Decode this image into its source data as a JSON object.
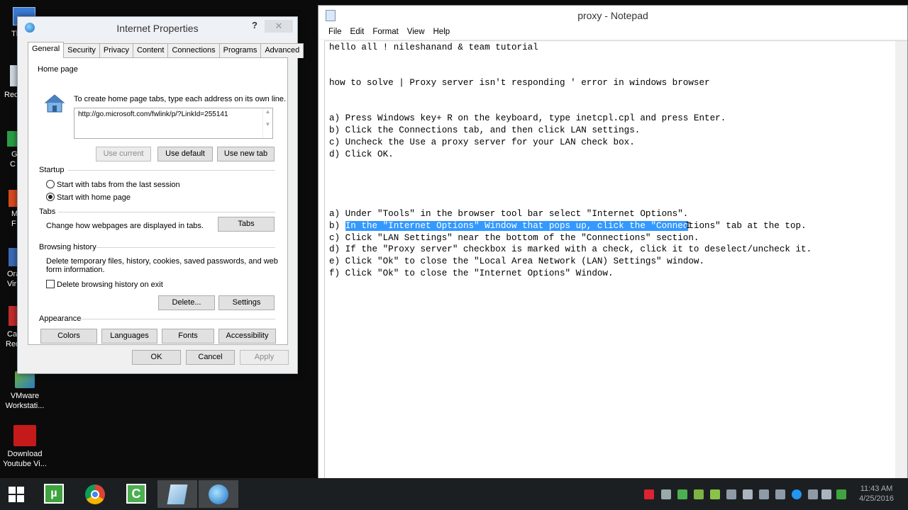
{
  "desktop": {
    "icons": [
      {
        "label1": "VMware",
        "label2": "Workstati..."
      },
      {
        "label1": "Download",
        "label2": "Youtube Vi..."
      }
    ],
    "partial_labels": [
      "Th",
      "Rec",
      "G",
      "C",
      "M",
      "F",
      "Ora",
      "Vir",
      "Ca",
      "Red"
    ]
  },
  "internet_properties": {
    "title": "Internet Properties",
    "help_glyph": "?",
    "close_glyph": "✕",
    "tabs": [
      "General",
      "Security",
      "Privacy",
      "Content",
      "Connections",
      "Programs",
      "Advanced"
    ],
    "home_page": {
      "label": "Home page",
      "hint": "To create home page tabs, type each address on its own line.",
      "url": "http://go.microsoft.com/fwlink/p/?LinkId=255141",
      "use_current": "Use current",
      "use_default": "Use default",
      "use_new_tab": "Use new tab"
    },
    "startup": {
      "label": "Startup",
      "option_last_session": "Start with tabs from the last session",
      "option_home_page": "Start with home page",
      "selected": "home_page"
    },
    "tabs_group": {
      "label": "Tabs",
      "hint": "Change how webpages are displayed in tabs.",
      "button": "Tabs"
    },
    "browsing_history": {
      "label": "Browsing history",
      "hint_line1": "Delete temporary files, history, cookies, saved passwords, and web",
      "hint_line2": "form information.",
      "delete_on_exit": "Delete browsing history on exit",
      "delete_button": "Delete...",
      "settings_button": "Settings"
    },
    "appearance": {
      "label": "Appearance",
      "colors": "Colors",
      "languages": "Languages",
      "fonts": "Fonts",
      "accessibility": "Accessibility"
    },
    "footer": {
      "ok": "OK",
      "cancel": "Cancel",
      "apply": "Apply"
    }
  },
  "notepad": {
    "title": "proxy - Notepad",
    "menu": [
      "File",
      "Edit",
      "Format",
      "View",
      "Help"
    ],
    "lines": {
      "l1": "hello all ! nileshanand & team tutorial",
      "l2": "how to solve | Proxy server isn't responding ' error in windows browser",
      "a1": "a) Press Windows key+ R on the keyboard, type inetcpl.cpl and press Enter.",
      "b1": "b) Click the Connections tab, and then click LAN settings.",
      "c1": "c) Uncheck the Use a proxy server for your LAN check box.",
      "d1": "d) Click OK.",
      "a2": "a) Under \"Tools\" in the browser tool bar select \"Internet Options\".",
      "b2_prefix": "b) ",
      "b2_selected": "In the \"Internet Options\" Window that pops up, click the \"Connec",
      "b2_rest": "tions\" tab at the top.",
      "c2": "c) Click \"LAN Settings\" near the bottom of the \"Connections\" section.",
      "d2": "d) If the \"Proxy server\" checkbox is marked with a check, click it to deselect/uncheck it.",
      "e2": "e) Click \"Ok\" to close the \"Local Area Network (LAN) Settings\" window.",
      "f2": "f) Click \"Ok\" to close the \"Internet Options\" Window."
    }
  },
  "taskbar": {
    "clock_time": "11:43 AM",
    "clock_date": "4/25/2016"
  },
  "colors": {
    "selection": "#3399ff",
    "taskbar": "#1c1f22"
  }
}
